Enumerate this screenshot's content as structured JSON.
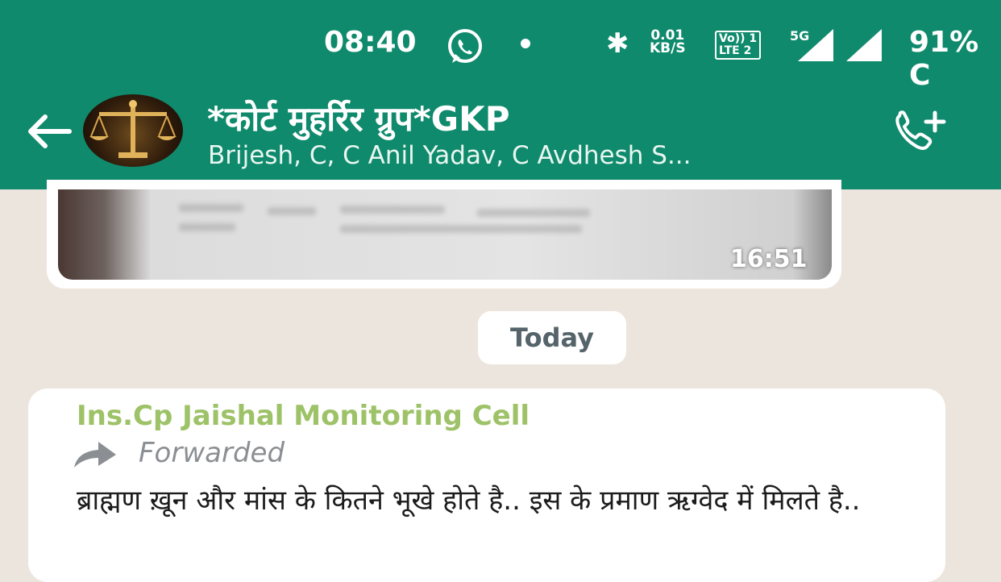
{
  "status_bar": {
    "time": "08:40",
    "data_rate_value": "0.01",
    "data_rate_unit": "KB/S",
    "volte_line1": "Vo)) 1",
    "volte_line2": "LTE 2",
    "network": "5G",
    "battery": "91% C"
  },
  "chat_header": {
    "title": "*कोर्ट मुहर्रिर ग्रुप*GKP",
    "members": "Brijesh, C, C Anil Yadav, C Avdhesh S..."
  },
  "messages": {
    "media_time": "16:51",
    "date_separator": "Today",
    "forwarded": {
      "sender": "Ins.Cp Jaishal Monitoring Cell",
      "forwarded_label": "Forwarded",
      "text": "ब्राह्मण ख़ून और मांस के कितने भूखे होते है.. इस के प्रमाण ऋग्वेद में मिलते है.."
    }
  },
  "colors": {
    "header": "#0f8a6c",
    "chat_bg": "#ece5dd",
    "sender_name": "#9dc267",
    "forwarded_text": "#8b8f93"
  },
  "icons": [
    "whatsapp-icon",
    "bluetooth-icon",
    "signal-icon",
    "back-arrow-icon",
    "group-avatar",
    "add-call-icon",
    "forward-arrow-icon"
  ]
}
